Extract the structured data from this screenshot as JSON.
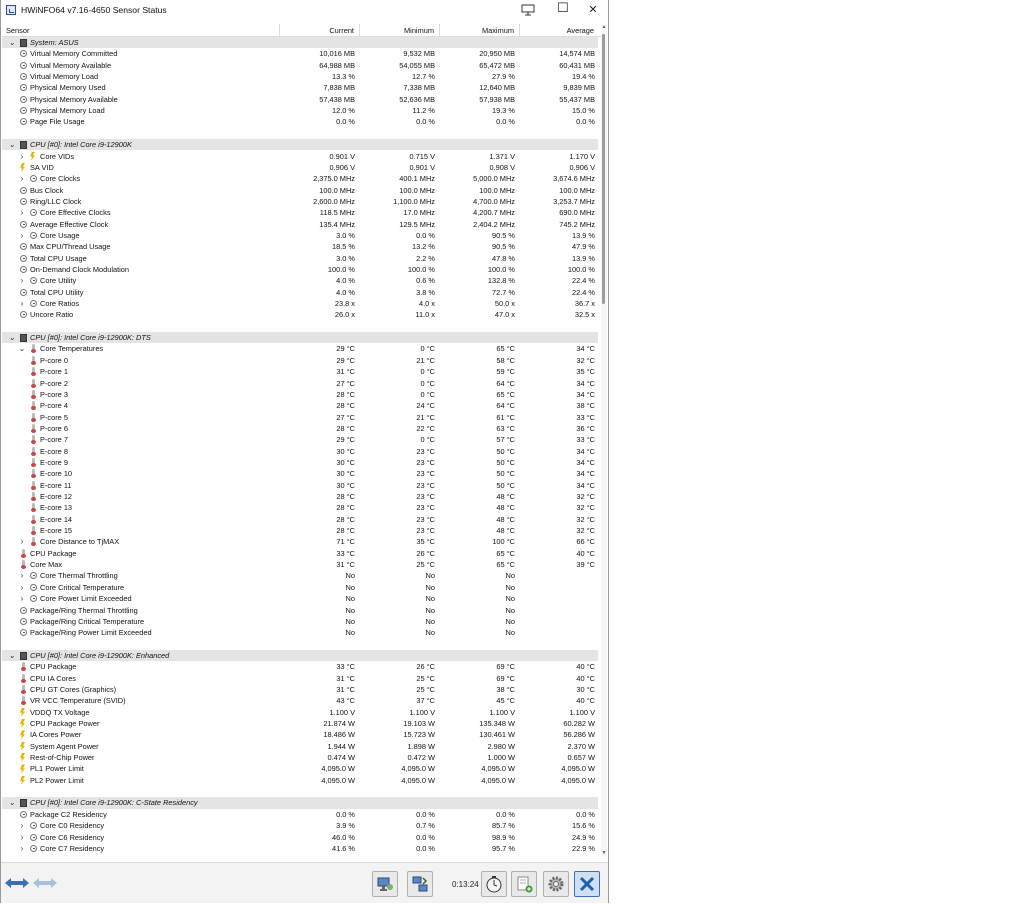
{
  "window": {
    "title": "HWiNFO64 v7.16-4650 Sensor Status"
  },
  "columns": {
    "sensor": "Sensor",
    "current": "Current",
    "minimum": "Minimum",
    "maximum": "Maximum",
    "average": "Average"
  },
  "rows": [
    {
      "t": "g",
      "n": "System: ASUS"
    },
    {
      "i": "clock",
      "n": "Virtual Memory Committed",
      "c": "10,016 MB",
      "mi": "9,532 MB",
      "ma": "20,950 MB",
      "a": "14,574 MB"
    },
    {
      "i": "clock",
      "n": "Virtual Memory Available",
      "c": "64,988 MB",
      "mi": "54,055 MB",
      "ma": "65,472 MB",
      "a": "60,431 MB"
    },
    {
      "i": "clock",
      "n": "Virtual Memory Load",
      "c": "13.3 %",
      "mi": "12.7 %",
      "ma": "27.9 %",
      "a": "19.4 %"
    },
    {
      "i": "clock",
      "n": "Physical Memory Used",
      "c": "7,838 MB",
      "mi": "7,338 MB",
      "ma": "12,640 MB",
      "a": "9,839 MB"
    },
    {
      "i": "clock",
      "n": "Physical Memory Available",
      "c": "57,438 MB",
      "mi": "52,636 MB",
      "ma": "57,938 MB",
      "a": "55,437 MB"
    },
    {
      "i": "clock",
      "n": "Physical Memory Load",
      "c": "12.0 %",
      "mi": "11.2 %",
      "ma": "19.3 %",
      "a": "15.0 %"
    },
    {
      "i": "clock",
      "n": "Page File Usage",
      "c": "0.0 %",
      "mi": "0.0 %",
      "ma": "0.0 %",
      "a": "0.0 %"
    },
    {
      "t": "e"
    },
    {
      "t": "g",
      "n": "CPU [#0]: Intel Core i9-12900K"
    },
    {
      "i": "bolt",
      "x": 1,
      "n": "Core VIDs",
      "c": "0.901 V",
      "mi": "0.715 V",
      "ma": "1.371 V",
      "a": "1.170 V"
    },
    {
      "i": "bolt",
      "n": "SA VID",
      "c": "0.906 V",
      "mi": "0.901 V",
      "ma": "0.908 V",
      "a": "0.906 V"
    },
    {
      "i": "clock",
      "x": 1,
      "n": "Core Clocks",
      "c": "2,375.0 MHz",
      "mi": "400.1 MHz",
      "ma": "5,000.0 MHz",
      "a": "3,674.6 MHz"
    },
    {
      "i": "clock",
      "n": "Bus Clock",
      "c": "100.0 MHz",
      "mi": "100.0 MHz",
      "ma": "100.0 MHz",
      "a": "100.0 MHz"
    },
    {
      "i": "clock",
      "n": "Ring/LLC Clock",
      "c": "2,600.0 MHz",
      "mi": "1,100.0 MHz",
      "ma": "4,700.0 MHz",
      "a": "3,253.7 MHz"
    },
    {
      "i": "clock",
      "x": 1,
      "n": "Core Effective Clocks",
      "c": "118.5 MHz",
      "mi": "17.0 MHz",
      "ma": "4,200.7 MHz",
      "a": "690.0 MHz"
    },
    {
      "i": "clock",
      "n": "Average Effective Clock",
      "c": "135.4 MHz",
      "mi": "129.5 MHz",
      "ma": "2,404.2 MHz",
      "a": "745.2 MHz"
    },
    {
      "i": "clock",
      "x": 1,
      "n": "Core Usage",
      "c": "3.0 %",
      "mi": "0.0 %",
      "ma": "90.5 %",
      "a": "13.9 %"
    },
    {
      "i": "clock",
      "n": "Max CPU/Thread Usage",
      "c": "18.5 %",
      "mi": "13.2 %",
      "ma": "90.5 %",
      "a": "47.9 %"
    },
    {
      "i": "clock",
      "n": "Total CPU Usage",
      "c": "3.0 %",
      "mi": "2.2 %",
      "ma": "47.8 %",
      "a": "13.9 %"
    },
    {
      "i": "clock",
      "n": "On-Demand Clock Modulation",
      "c": "100.0 %",
      "mi": "100.0 %",
      "ma": "100.0 %",
      "a": "100.0 %"
    },
    {
      "i": "clock",
      "x": 1,
      "n": "Core Utility",
      "c": "4.0 %",
      "mi": "0.6 %",
      "ma": "132.8 %",
      "a": "22.4 %"
    },
    {
      "i": "clock",
      "n": "Total CPU Utility",
      "c": "4.0 %",
      "mi": "3.8 %",
      "ma": "72.7 %",
      "a": "22.4 %"
    },
    {
      "i": "clock",
      "x": 1,
      "n": "Core Ratios",
      "c": "23.8 x",
      "mi": "4.0 x",
      "ma": "50.0 x",
      "a": "36.7 x"
    },
    {
      "i": "clock",
      "n": "Uncore Ratio",
      "c": "26.0 x",
      "mi": "11.0 x",
      "ma": "47.0 x",
      "a": "32.5 x"
    },
    {
      "t": "e"
    },
    {
      "t": "g",
      "n": "CPU [#0]: Intel Core i9-12900K: DTS"
    },
    {
      "i": "therm",
      "x": 2,
      "n": "Core Temperatures",
      "c": "29 °C",
      "mi": "0 °C",
      "ma": "65 °C",
      "a": "34 °C"
    },
    {
      "i": "therm",
      "s": 1,
      "n": "P-core 0",
      "c": "29 °C",
      "mi": "21 °C",
      "ma": "58 °C",
      "a": "32 °C"
    },
    {
      "i": "therm",
      "s": 1,
      "n": "P-core 1",
      "c": "31 °C",
      "mi": "0 °C",
      "ma": "59 °C",
      "a": "35 °C"
    },
    {
      "i": "therm",
      "s": 1,
      "n": "P-core 2",
      "c": "27 °C",
      "mi": "0 °C",
      "ma": "64 °C",
      "a": "34 °C"
    },
    {
      "i": "therm",
      "s": 1,
      "n": "P-core 3",
      "c": "28 °C",
      "mi": "0 °C",
      "ma": "65 °C",
      "a": "34 °C"
    },
    {
      "i": "therm",
      "s": 1,
      "n": "P-core 4",
      "c": "28 °C",
      "mi": "24 °C",
      "ma": "64 °C",
      "a": "38 °C"
    },
    {
      "i": "therm",
      "s": 1,
      "n": "P-core 5",
      "c": "27 °C",
      "mi": "21 °C",
      "ma": "61 °C",
      "a": "33 °C"
    },
    {
      "i": "therm",
      "s": 1,
      "n": "P-core 6",
      "c": "28 °C",
      "mi": "22 °C",
      "ma": "63 °C",
      "a": "36 °C"
    },
    {
      "i": "therm",
      "s": 1,
      "n": "P-core 7",
      "c": "29 °C",
      "mi": "0 °C",
      "ma": "57 °C",
      "a": "33 °C"
    },
    {
      "i": "therm",
      "s": 1,
      "n": "E-core 8",
      "c": "30 °C",
      "mi": "23 °C",
      "ma": "50 °C",
      "a": "34 °C"
    },
    {
      "i": "therm",
      "s": 1,
      "n": "E-core 9",
      "c": "30 °C",
      "mi": "23 °C",
      "ma": "50 °C",
      "a": "34 °C"
    },
    {
      "i": "therm",
      "s": 1,
      "n": "E-core 10",
      "c": "30 °C",
      "mi": "23 °C",
      "ma": "50 °C",
      "a": "34 °C"
    },
    {
      "i": "therm",
      "s": 1,
      "n": "E-core 11",
      "c": "30 °C",
      "mi": "23 °C",
      "ma": "50 °C",
      "a": "34 °C"
    },
    {
      "i": "therm",
      "s": 1,
      "n": "E-core 12",
      "c": "28 °C",
      "mi": "23 °C",
      "ma": "48 °C",
      "a": "32 °C"
    },
    {
      "i": "therm",
      "s": 1,
      "n": "E-core 13",
      "c": "28 °C",
      "mi": "23 °C",
      "ma": "48 °C",
      "a": "32 °C"
    },
    {
      "i": "therm",
      "s": 1,
      "n": "E-core 14",
      "c": "28 °C",
      "mi": "23 °C",
      "ma": "48 °C",
      "a": "32 °C"
    },
    {
      "i": "therm",
      "s": 1,
      "n": "E-core 15",
      "c": "28 °C",
      "mi": "23 °C",
      "ma": "48 °C",
      "a": "32 °C"
    },
    {
      "i": "therm",
      "x": 1,
      "n": "Core Distance to TjMAX",
      "c": "71 °C",
      "mi": "35 °C",
      "ma": "100 °C",
      "a": "66 °C"
    },
    {
      "i": "therm",
      "n": "CPU Package",
      "c": "33 °C",
      "mi": "26 °C",
      "ma": "65 °C",
      "a": "40 °C"
    },
    {
      "i": "therm",
      "n": "Core Max",
      "c": "31 °C",
      "mi": "25 °C",
      "ma": "65 °C",
      "a": "39 °C"
    },
    {
      "i": "clock",
      "x": 1,
      "n": "Core Thermal Throttling",
      "c": "No",
      "mi": "No",
      "ma": "No",
      "a": ""
    },
    {
      "i": "clock",
      "x": 1,
      "n": "Core Critical Temperature",
      "c": "No",
      "mi": "No",
      "ma": "No",
      "a": ""
    },
    {
      "i": "clock",
      "x": 1,
      "n": "Core Power Limit Exceeded",
      "c": "No",
      "mi": "No",
      "ma": "No",
      "a": ""
    },
    {
      "i": "clock",
      "n": "Package/Ring Thermal Throttling",
      "c": "No",
      "mi": "No",
      "ma": "No",
      "a": ""
    },
    {
      "i": "clock",
      "n": "Package/Ring Critical Temperature",
      "c": "No",
      "mi": "No",
      "ma": "No",
      "a": ""
    },
    {
      "i": "clock",
      "n": "Package/Ring Power Limit Exceeded",
      "c": "No",
      "mi": "No",
      "ma": "No",
      "a": ""
    },
    {
      "t": "e"
    },
    {
      "t": "g",
      "n": "CPU [#0]: Intel Core i9-12900K: Enhanced"
    },
    {
      "i": "therm",
      "n": "CPU Package",
      "c": "33 °C",
      "mi": "26 °C",
      "ma": "69 °C",
      "a": "40 °C"
    },
    {
      "i": "therm",
      "n": "CPU IA Cores",
      "c": "31 °C",
      "mi": "25 °C",
      "ma": "69 °C",
      "a": "40 °C"
    },
    {
      "i": "therm",
      "n": "CPU GT Cores (Graphics)",
      "c": "31 °C",
      "mi": "25 °C",
      "ma": "38 °C",
      "a": "30 °C"
    },
    {
      "i": "therm",
      "n": "VR VCC Temperature (SVID)",
      "c": "43 °C",
      "mi": "37 °C",
      "ma": "45 °C",
      "a": "40 °C"
    },
    {
      "i": "bolt",
      "n": "VDDQ TX Voltage",
      "c": "1.100 V",
      "mi": "1.100 V",
      "ma": "1.100 V",
      "a": "1.100 V"
    },
    {
      "i": "bolt",
      "n": "CPU Package Power",
      "c": "21.874 W",
      "mi": "19.103 W",
      "ma": "135.348 W",
      "a": "60.282 W"
    },
    {
      "i": "bolt",
      "n": "IA Cores Power",
      "c": "18.486 W",
      "mi": "15.723 W",
      "ma": "130.461 W",
      "a": "56.286 W"
    },
    {
      "i": "bolt",
      "n": "System Agent Power",
      "c": "1.944 W",
      "mi": "1.898 W",
      "ma": "2.980 W",
      "a": "2.370 W"
    },
    {
      "i": "bolt",
      "n": "Rest-of-Chip Power",
      "c": "0.474 W",
      "mi": "0.472 W",
      "ma": "1.000 W",
      "a": "0.657 W"
    },
    {
      "i": "bolt",
      "n": "PL1 Power Limit",
      "c": "4,095.0 W",
      "mi": "4,095.0 W",
      "ma": "4,095.0 W",
      "a": "4,095.0 W"
    },
    {
      "i": "bolt",
      "n": "PL2 Power Limit",
      "c": "4,095.0 W",
      "mi": "4,095.0 W",
      "ma": "4,095.0 W",
      "a": "4,095.0 W"
    },
    {
      "t": "e"
    },
    {
      "t": "g",
      "n": "CPU [#0]: Intel Core i9-12900K: C-State Residency"
    },
    {
      "i": "clock",
      "n": "Package C2 Residency",
      "c": "0.0 %",
      "mi": "0.0 %",
      "ma": "0.0 %",
      "a": "0.0 %"
    },
    {
      "i": "clock",
      "x": 1,
      "n": "Core C0 Residency",
      "c": "3.9 %",
      "mi": "0.7 %",
      "ma": "85.7 %",
      "a": "15.6 %"
    },
    {
      "i": "clock",
      "x": 1,
      "n": "Core C6 Residency",
      "c": "46.0 %",
      "mi": "0.0 %",
      "ma": "98.9 %",
      "a": "24.9 %"
    },
    {
      "i": "clock",
      "x": 1,
      "n": "Core C7 Residency",
      "c": "41.6 %",
      "mi": "0.0 %",
      "ma": "95.7 %",
      "a": "22.9 %"
    }
  ],
  "toolbar": {
    "timer": "0:13:24"
  },
  "icons": {
    "nav_prev": "double-arrow-left-icon",
    "nav_next": "double-arrow-right-icon",
    "network": "network-computer-icon",
    "sync": "sync-icon",
    "clock": "stopwatch-icon",
    "log": "add-log-icon",
    "settings": "gear-icon",
    "close": "close-icon"
  }
}
